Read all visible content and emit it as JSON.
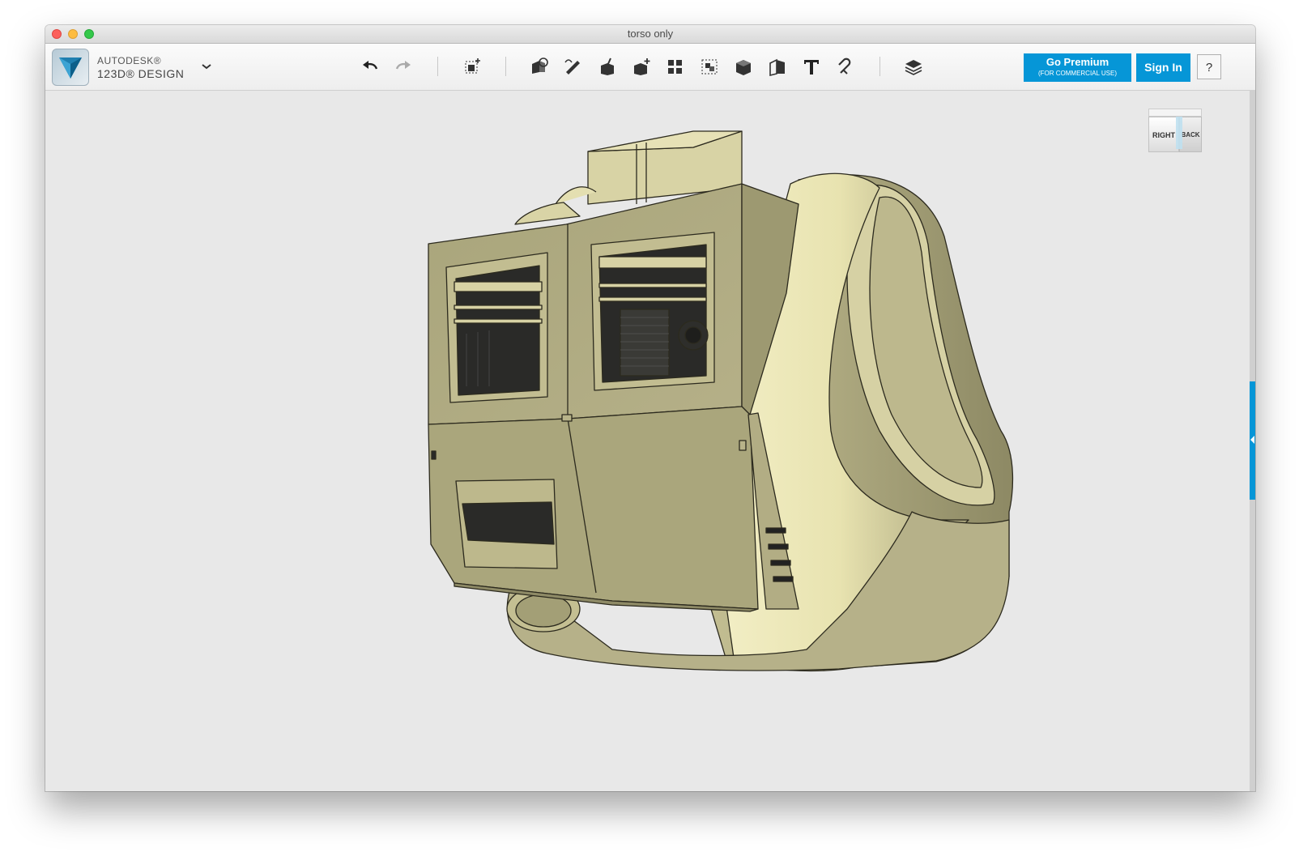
{
  "window": {
    "title": "torso only"
  },
  "brand": {
    "line1": "AUTODESK®",
    "line2": "123D® DESIGN",
    "menu_icon": "chevron-down-icon"
  },
  "toolbar": {
    "tools": [
      {
        "name": "undo-button",
        "icon": "undo-arrow-icon"
      },
      {
        "name": "redo-button",
        "icon": "redo-arrow-icon"
      },
      {
        "name": "transform-button",
        "icon": "transform-cube-icon"
      },
      {
        "name": "primitives-button",
        "icon": "primitives-icon"
      },
      {
        "name": "sketch-button",
        "icon": "sketch-pencil-icon"
      },
      {
        "name": "construct-button",
        "icon": "construct-icon"
      },
      {
        "name": "modify-button",
        "icon": "modify-icon"
      },
      {
        "name": "pattern-button",
        "icon": "pattern-grid-icon"
      },
      {
        "name": "grouping-button",
        "icon": "grouping-icon"
      },
      {
        "name": "combine-button",
        "icon": "combine-icon"
      },
      {
        "name": "measure-button",
        "icon": "measure-icon"
      },
      {
        "name": "text-button",
        "icon": "text-T-icon"
      },
      {
        "name": "snap-button",
        "icon": "snap-icon"
      },
      {
        "name": "materials-button",
        "icon": "layers-icon"
      }
    ],
    "premium_label": "Go Premium",
    "premium_sublabel": "(FOR COMMERCIAL USE)",
    "signin_label": "Sign In",
    "help_label": "?"
  },
  "viewcube": {
    "right": "RIGHT",
    "back": "BACK"
  },
  "colors": {
    "accent": "#0696d7",
    "model_face": "#a8a47a",
    "model_light": "#e8e4b6",
    "viewport": "#e8e8e8"
  }
}
